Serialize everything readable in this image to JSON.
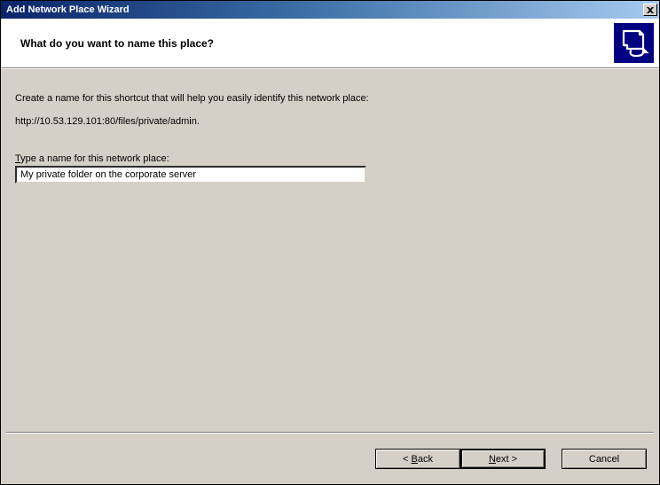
{
  "titlebar": {
    "title": "Add Network Place Wizard",
    "close_label": "X"
  },
  "header": {
    "question": "What do you want to name this place?"
  },
  "body": {
    "instruction": "Create a name for this shortcut that will help you easily identify this network place:",
    "address": "http://10.53.129.101:80/files/private/admin.",
    "name_label_pre": "",
    "name_label_m": "T",
    "name_label_post": "ype a name for this network place:",
    "name_value": "My private folder on the corporate server"
  },
  "buttons": {
    "back_pre": "< ",
    "back_m": "B",
    "back_post": "ack",
    "next_m": "N",
    "next_post": "ext >",
    "cancel": "Cancel"
  }
}
